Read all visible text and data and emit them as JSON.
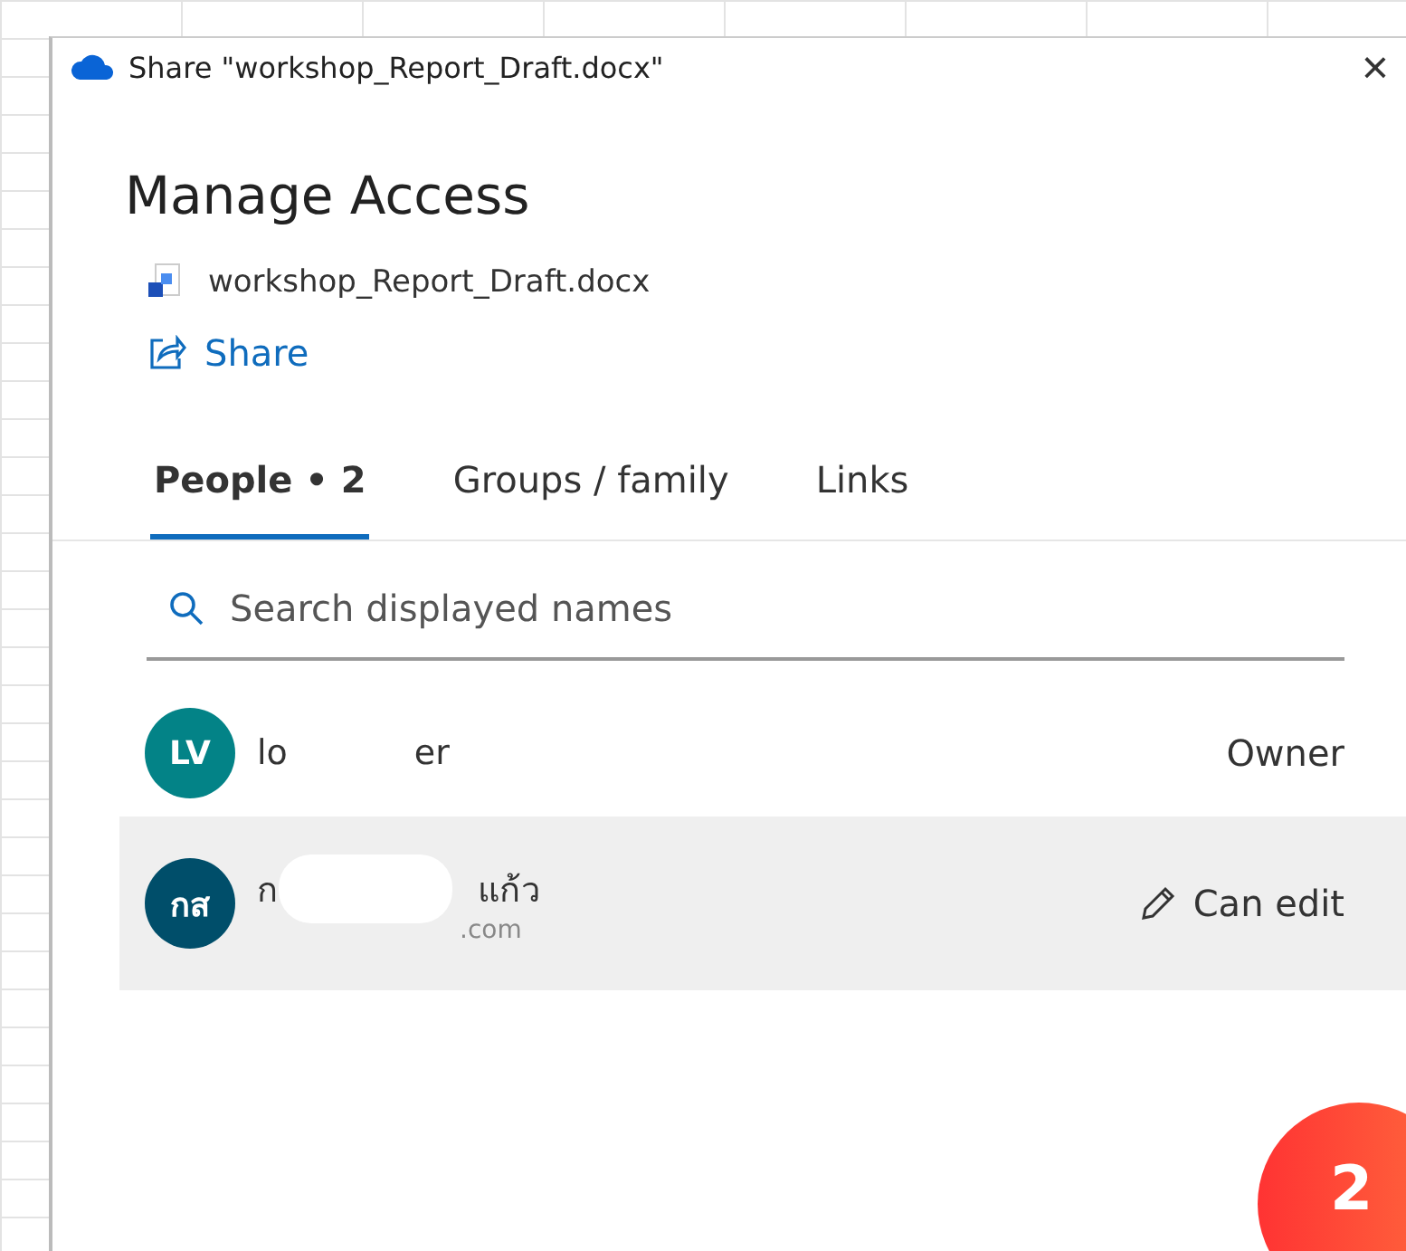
{
  "window": {
    "title": "Share \"workshop_Report_Draft.docx\"",
    "close": "×"
  },
  "heading": "Manage Access",
  "file": {
    "name": "workshop_Report_Draft.docx"
  },
  "share_link": "Share",
  "tabs": [
    {
      "label": "People • 2",
      "selected": true
    },
    {
      "label": "Groups / family",
      "selected": false
    },
    {
      "label": "Links",
      "selected": false
    }
  ],
  "search": {
    "placeholder": "Search displayed names"
  },
  "people": [
    {
      "initials": "LV",
      "color": "#038387",
      "name_start": "lo",
      "name_end": "er",
      "role": "Owner",
      "kind": "owner",
      "selected": false
    },
    {
      "initials": "กส",
      "color": "#004e6a",
      "name_start": "ก",
      "name_end": "แก้ว",
      "email_end": ".com",
      "role": "Can edit",
      "kind": "editor",
      "selected": true
    }
  ],
  "step_badge": "2"
}
